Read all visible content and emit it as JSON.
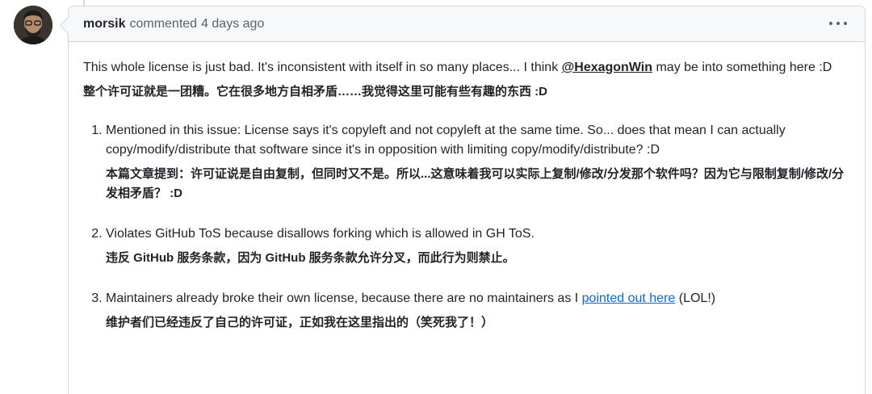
{
  "comment": {
    "author": "morsik",
    "action": "commented",
    "time": "4 days ago"
  },
  "body": {
    "intro_before": "This whole license is just bad. It's inconsistent with itself in so many places... I think ",
    "mention": "@HexagonWin",
    "intro_after": " may be into something here :D",
    "intro_zh": "整个许可证就是一团糟。它在很多地方自相矛盾……我觉得这里可能有些有趣的东西 :D",
    "items": [
      {
        "text": "Mentioned in this issue: License says it's copyleft and not copyleft at the same time. So... does that mean I can actually copy/modify/distribute that software since it's in opposition with limiting copy/modify/distribute? :D",
        "zh": "本篇文章提到：许可证说是自由复制，但同时又不是。所以...这意味着我可以实际上复制/修改/分发那个软件吗？因为它与限制复制/修改/分发相矛盾？ :D"
      },
      {
        "text": "Violates GitHub ToS because disallows forking which is allowed in GH ToS.",
        "zh": "违反 GitHub 服务条款，因为 GitHub 服务条款允许分叉，而此行为则禁止。"
      },
      {
        "text_before": "Maintainers already broke their own license, because there are no maintainers as I ",
        "link": "pointed out here",
        "text_after": " (LOL!)",
        "zh": "维护者们已经违反了自己的许可证，正如我在这里指出的（笑死我了！）"
      }
    ]
  },
  "icons": {
    "avatar": "avatar",
    "menu": "kebab-horizontal-icon"
  }
}
